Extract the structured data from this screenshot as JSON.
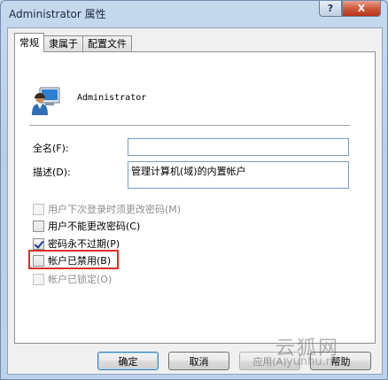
{
  "window": {
    "title": "Administrator 属性",
    "help_label": "?",
    "close_label": "X"
  },
  "tabs": [
    {
      "label": "常规",
      "active": true
    },
    {
      "label": "隶属于",
      "active": false
    },
    {
      "label": "配置文件",
      "active": false
    }
  ],
  "general": {
    "user_icon": "user-icon",
    "username": "Administrator",
    "fullname": {
      "label": "全名(F):",
      "value": ""
    },
    "description": {
      "label": "描述(D):",
      "value": "管理计算机(域)的内置帐户"
    },
    "options": [
      {
        "label": "用户下次登录时须更改密码(M)",
        "checked": false,
        "enabled": false
      },
      {
        "label": "用户不能更改密码(C)",
        "checked": false,
        "enabled": true
      },
      {
        "label": "密码永不过期(P)",
        "checked": true,
        "enabled": true
      },
      {
        "label": "帐户已禁用(B)",
        "checked": false,
        "enabled": true,
        "highlighted": true
      },
      {
        "label": "帐户已锁定(O)",
        "checked": false,
        "enabled": false
      }
    ]
  },
  "buttons": {
    "ok": "确定",
    "cancel": "取消",
    "apply": "应用(A)",
    "help": "帮助"
  },
  "watermark": {
    "text": "云狐网",
    "url": "yunhu.net"
  },
  "colors": {
    "highlight_border": "#d9302a",
    "title_bar": "#c6d9ee",
    "close_button": "#c9492b"
  }
}
